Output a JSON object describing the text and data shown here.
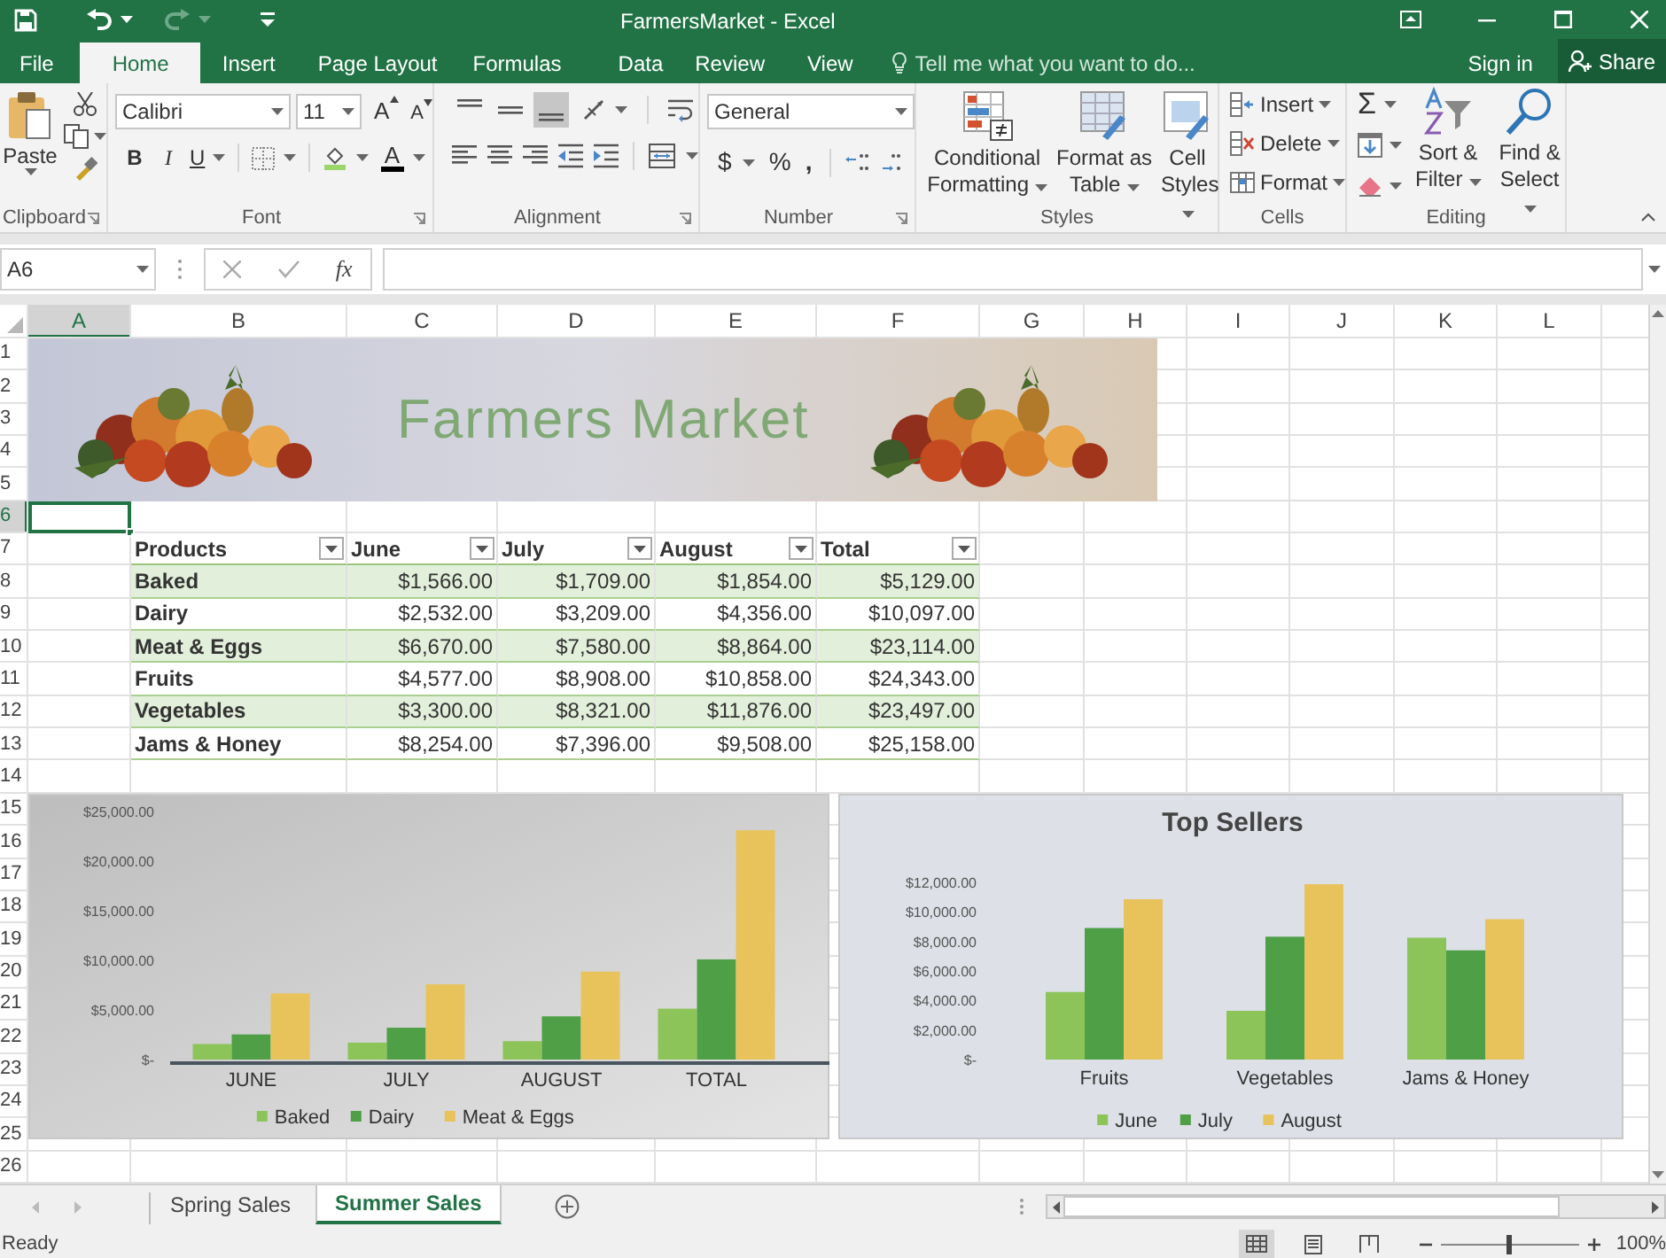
{
  "window": {
    "title": "FarmersMarket - Excel"
  },
  "ribbon_tabs": [
    {
      "label": "File",
      "selected": false
    },
    {
      "label": "Home",
      "selected": true
    },
    {
      "label": "Insert",
      "selected": false
    },
    {
      "label": "Page Layout",
      "selected": false
    },
    {
      "label": "Formulas",
      "selected": false
    },
    {
      "label": "Data",
      "selected": false
    },
    {
      "label": "Review",
      "selected": false
    },
    {
      "label": "View",
      "selected": false
    }
  ],
  "tell_me": {
    "placeholder": "Tell me what you want to do..."
  },
  "account": {
    "sign_in": "Sign in",
    "share": "Share"
  },
  "ribbon": {
    "clipboard": {
      "label": "Clipboard",
      "paste": "Paste"
    },
    "font": {
      "label": "Font",
      "font_name": "Calibri",
      "font_size": "11",
      "grow": "A",
      "shrink": "A",
      "bold": "B",
      "italic": "I",
      "underline": "U",
      "font_color": "A"
    },
    "alignment": {
      "label": "Alignment",
      "vertical_align": [
        {
          "selected": false
        },
        {
          "selected": false
        },
        {
          "selected": true
        }
      ]
    },
    "number": {
      "label": "Number",
      "format": "General",
      "currency": "$",
      "percent": "%",
      "comma": ","
    },
    "styles": {
      "label": "Styles",
      "buttons": [
        "Conditional Formatting",
        "Format as Table",
        "Cell Styles"
      ]
    },
    "cells": {
      "label": "Cells",
      "buttons": [
        "Insert",
        "Delete",
        "Format"
      ]
    },
    "editing": {
      "label": "Editing",
      "autosum": "Σ",
      "buttons": [
        "Sort & Filter",
        "Find & Select"
      ]
    }
  },
  "formula_bar": {
    "name_box": "A6",
    "function_label": "fx"
  },
  "sheet": {
    "columns": [
      {
        "label": "A",
        "selected": true
      },
      {
        "label": "B",
        "selected": false
      },
      {
        "label": "C",
        "selected": false
      },
      {
        "label": "D",
        "selected": false
      },
      {
        "label": "E",
        "selected": false
      },
      {
        "label": "F",
        "selected": false
      },
      {
        "label": "G",
        "selected": false
      },
      {
        "label": "H",
        "selected": false
      },
      {
        "label": "I",
        "selected": false
      },
      {
        "label": "J",
        "selected": false
      },
      {
        "label": "K",
        "selected": false
      },
      {
        "label": "L",
        "selected": false
      }
    ],
    "rows": [
      {
        "label": "1",
        "selected": false
      },
      {
        "label": "2",
        "selected": false
      },
      {
        "label": "3",
        "selected": false
      },
      {
        "label": "4",
        "selected": false
      },
      {
        "label": "5",
        "selected": false
      },
      {
        "label": "6",
        "selected": true
      },
      {
        "label": "7",
        "selected": false
      },
      {
        "label": "8",
        "selected": false
      },
      {
        "label": "9",
        "selected": false
      },
      {
        "label": "10",
        "selected": false
      },
      {
        "label": "11",
        "selected": false
      },
      {
        "label": "12",
        "selected": false
      },
      {
        "label": "13",
        "selected": false
      },
      {
        "label": "14",
        "selected": false
      },
      {
        "label": "15",
        "selected": false
      },
      {
        "label": "16",
        "selected": false
      },
      {
        "label": "17",
        "selected": false
      },
      {
        "label": "18",
        "selected": false
      },
      {
        "label": "19",
        "selected": false
      },
      {
        "label": "20",
        "selected": false
      },
      {
        "label": "21",
        "selected": false
      },
      {
        "label": "22",
        "selected": false
      },
      {
        "label": "23",
        "selected": false
      },
      {
        "label": "24",
        "selected": false
      },
      {
        "label": "25",
        "selected": false
      },
      {
        "label": "26",
        "selected": false
      }
    ]
  },
  "banner": {
    "title": "Farmers Market"
  },
  "table": {
    "columns": [
      "Products",
      "June",
      "July",
      "August",
      "Total"
    ],
    "rows": [
      [
        "Baked",
        "$1,566.00",
        "$1,709.00",
        "$1,854.00",
        "$5,129.00"
      ],
      [
        "Dairy",
        "$2,532.00",
        "$3,209.00",
        "$4,356.00",
        "$10,097.00"
      ],
      [
        "Meat & Eggs",
        "$6,670.00",
        "$7,580.00",
        "$8,864.00",
        "$23,114.00"
      ],
      [
        "Fruits",
        "$4,577.00",
        "$8,908.00",
        "$10,858.00",
        "$24,343.00"
      ],
      [
        "Vegetables",
        "$3,300.00",
        "$8,321.00",
        "$11,876.00",
        "$23,497.00"
      ],
      [
        "Jams & Honey",
        "$8,254.00",
        "$7,396.00",
        "$9,508.00",
        "$25,158.00"
      ]
    ]
  },
  "charts": [
    {
      "chart_data": {
        "type": "bar",
        "categories": [
          "JUNE",
          "JULY",
          "AUGUST",
          "TOTAL"
        ],
        "series": [
          {
            "name": "Baked",
            "color": "#8cc45a",
            "values": [
              1566,
              1709,
              1854,
              5129
            ]
          },
          {
            "name": "Dairy",
            "color": "#4e9f46",
            "values": [
              2532,
              3209,
              4356,
              10097
            ]
          },
          {
            "name": "Meat & Eggs",
            "color": "#e8c35c",
            "values": [
              6670,
              7580,
              8864,
              23114
            ]
          }
        ],
        "legend": true,
        "ylim": [
          0,
          25000
        ],
        "yticks": [
          {
            "value": 0,
            "label": "$-"
          },
          {
            "value": 5000,
            "label": "$5,000.00"
          },
          {
            "value": 10000,
            "label": "$10,000.00"
          },
          {
            "value": 15000,
            "label": "$15,000.00"
          },
          {
            "value": 20000,
            "label": "$20,000.00"
          },
          {
            "value": 25000,
            "label": "$25,000.00"
          }
        ]
      }
    },
    {
      "chart_data": {
        "type": "bar",
        "title": "Top Sellers",
        "categories": [
          "Fruits",
          "Vegetables",
          "Jams & Honey"
        ],
        "series": [
          {
            "name": "June",
            "color": "#8cc45a",
            "values": [
              4577,
              3300,
              8254
            ]
          },
          {
            "name": "July",
            "color": "#4e9f46",
            "values": [
              8908,
              8321,
              7396
            ]
          },
          {
            "name": "August",
            "color": "#e8c35c",
            "values": [
              10858,
              11876,
              9508
            ]
          }
        ],
        "legend": true,
        "ylim": [
          0,
          12000
        ],
        "yticks": [
          {
            "value": 0,
            "label": "$-"
          },
          {
            "value": 2000,
            "label": "$2,000.00"
          },
          {
            "value": 4000,
            "label": "$4,000.00"
          },
          {
            "value": 6000,
            "label": "$6,000.00"
          },
          {
            "value": 8000,
            "label": "$8,000.00"
          },
          {
            "value": 10000,
            "label": "$10,000.00"
          },
          {
            "value": 12000,
            "label": "$12,000.00"
          }
        ]
      }
    }
  ],
  "sheet_tabs": [
    {
      "label": "Spring Sales",
      "selected": false
    },
    {
      "label": "Summer Sales",
      "selected": true
    }
  ],
  "status_bar": {
    "status": "Ready",
    "views": [
      {
        "selected": true
      },
      {
        "selected": false
      },
      {
        "selected": false
      }
    ],
    "zoom_slider": {
      "level": 0.5
    },
    "zoom": "100%"
  }
}
